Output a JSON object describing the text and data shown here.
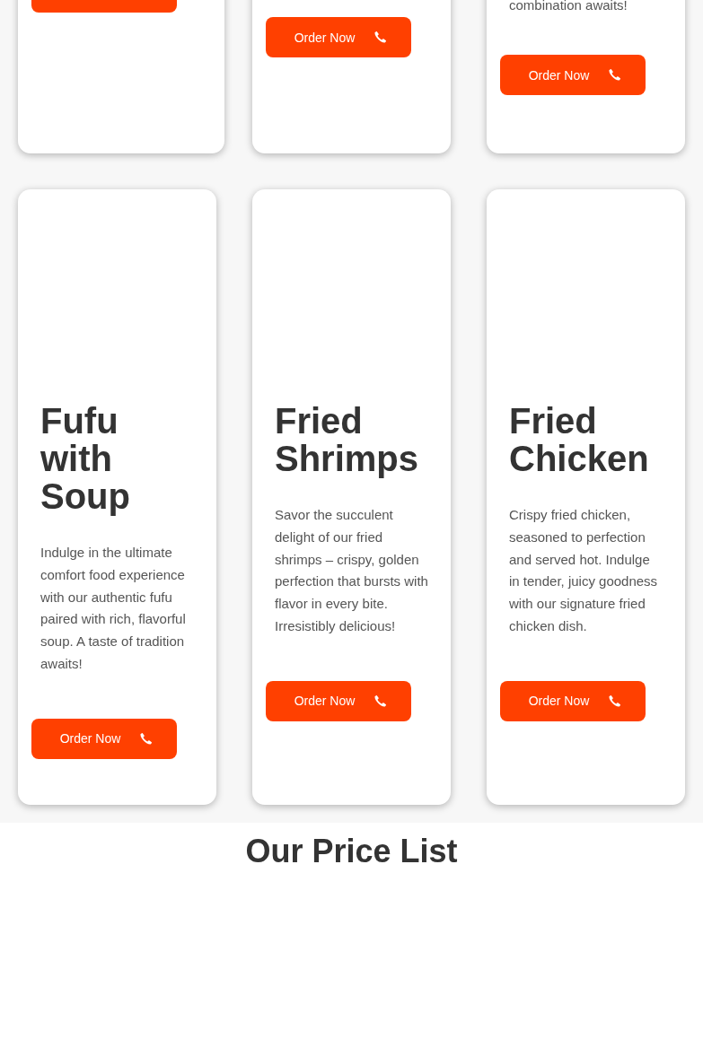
{
  "top_cards": [
    {
      "button": {
        "clipped": true
      }
    },
    {
      "button": {
        "label": "Order Now"
      }
    },
    {
      "description": "combination awaits!",
      "button": {
        "label": "Order Now"
      }
    }
  ],
  "cards": [
    {
      "title": "Fufu with Soup",
      "description": "Indulge in the ultimate comfort food experience with our authentic fufu paired with rich, flavorful soup. A taste of tradition awaits!",
      "button": {
        "label": "Order Now"
      }
    },
    {
      "title": "Fried Shrimps",
      "description": "Savor the succulent delight of our fried shrimps – crispy, golden perfection that bursts with flavor in every bite. Irresistibly delicious!",
      "button": {
        "label": "Order Now"
      }
    },
    {
      "title": "Fried Chicken",
      "description": "Crispy fried chicken, seasoned to perfection and served hot. Indulge in tender, juicy goodness with our signature fried chicken dish.",
      "button": {
        "label": "Order Now"
      }
    }
  ],
  "price_section": {
    "heading": "Our Price List"
  }
}
